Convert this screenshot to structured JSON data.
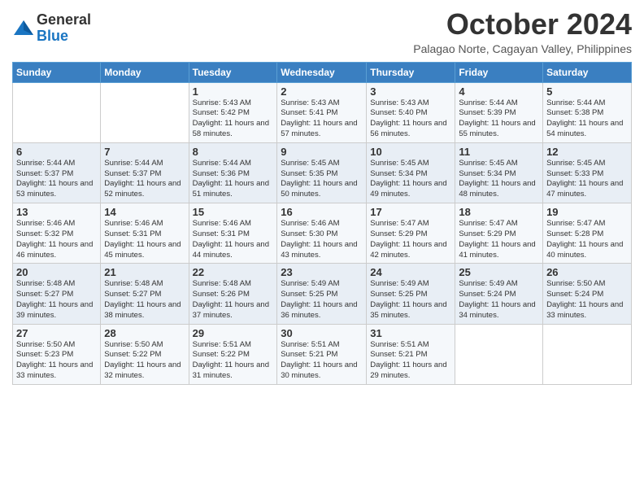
{
  "header": {
    "logo": {
      "general": "General",
      "blue": "Blue"
    },
    "title": "October 2024",
    "location": "Palagao Norte, Cagayan Valley, Philippines"
  },
  "weekdays": [
    "Sunday",
    "Monday",
    "Tuesday",
    "Wednesday",
    "Thursday",
    "Friday",
    "Saturday"
  ],
  "weeks": [
    [
      {
        "day": "",
        "detail": ""
      },
      {
        "day": "",
        "detail": ""
      },
      {
        "day": "1",
        "detail": "Sunrise: 5:43 AM\nSunset: 5:42 PM\nDaylight: 11 hours and 58 minutes."
      },
      {
        "day": "2",
        "detail": "Sunrise: 5:43 AM\nSunset: 5:41 PM\nDaylight: 11 hours and 57 minutes."
      },
      {
        "day": "3",
        "detail": "Sunrise: 5:43 AM\nSunset: 5:40 PM\nDaylight: 11 hours and 56 minutes."
      },
      {
        "day": "4",
        "detail": "Sunrise: 5:44 AM\nSunset: 5:39 PM\nDaylight: 11 hours and 55 minutes."
      },
      {
        "day": "5",
        "detail": "Sunrise: 5:44 AM\nSunset: 5:38 PM\nDaylight: 11 hours and 54 minutes."
      }
    ],
    [
      {
        "day": "6",
        "detail": "Sunrise: 5:44 AM\nSunset: 5:37 PM\nDaylight: 11 hours and 53 minutes."
      },
      {
        "day": "7",
        "detail": "Sunrise: 5:44 AM\nSunset: 5:37 PM\nDaylight: 11 hours and 52 minutes."
      },
      {
        "day": "8",
        "detail": "Sunrise: 5:44 AM\nSunset: 5:36 PM\nDaylight: 11 hours and 51 minutes."
      },
      {
        "day": "9",
        "detail": "Sunrise: 5:45 AM\nSunset: 5:35 PM\nDaylight: 11 hours and 50 minutes."
      },
      {
        "day": "10",
        "detail": "Sunrise: 5:45 AM\nSunset: 5:34 PM\nDaylight: 11 hours and 49 minutes."
      },
      {
        "day": "11",
        "detail": "Sunrise: 5:45 AM\nSunset: 5:34 PM\nDaylight: 11 hours and 48 minutes."
      },
      {
        "day": "12",
        "detail": "Sunrise: 5:45 AM\nSunset: 5:33 PM\nDaylight: 11 hours and 47 minutes."
      }
    ],
    [
      {
        "day": "13",
        "detail": "Sunrise: 5:46 AM\nSunset: 5:32 PM\nDaylight: 11 hours and 46 minutes."
      },
      {
        "day": "14",
        "detail": "Sunrise: 5:46 AM\nSunset: 5:31 PM\nDaylight: 11 hours and 45 minutes."
      },
      {
        "day": "15",
        "detail": "Sunrise: 5:46 AM\nSunset: 5:31 PM\nDaylight: 11 hours and 44 minutes."
      },
      {
        "day": "16",
        "detail": "Sunrise: 5:46 AM\nSunset: 5:30 PM\nDaylight: 11 hours and 43 minutes."
      },
      {
        "day": "17",
        "detail": "Sunrise: 5:47 AM\nSunset: 5:29 PM\nDaylight: 11 hours and 42 minutes."
      },
      {
        "day": "18",
        "detail": "Sunrise: 5:47 AM\nSunset: 5:29 PM\nDaylight: 11 hours and 41 minutes."
      },
      {
        "day": "19",
        "detail": "Sunrise: 5:47 AM\nSunset: 5:28 PM\nDaylight: 11 hours and 40 minutes."
      }
    ],
    [
      {
        "day": "20",
        "detail": "Sunrise: 5:48 AM\nSunset: 5:27 PM\nDaylight: 11 hours and 39 minutes."
      },
      {
        "day": "21",
        "detail": "Sunrise: 5:48 AM\nSunset: 5:27 PM\nDaylight: 11 hours and 38 minutes."
      },
      {
        "day": "22",
        "detail": "Sunrise: 5:48 AM\nSunset: 5:26 PM\nDaylight: 11 hours and 37 minutes."
      },
      {
        "day": "23",
        "detail": "Sunrise: 5:49 AM\nSunset: 5:25 PM\nDaylight: 11 hours and 36 minutes."
      },
      {
        "day": "24",
        "detail": "Sunrise: 5:49 AM\nSunset: 5:25 PM\nDaylight: 11 hours and 35 minutes."
      },
      {
        "day": "25",
        "detail": "Sunrise: 5:49 AM\nSunset: 5:24 PM\nDaylight: 11 hours and 34 minutes."
      },
      {
        "day": "26",
        "detail": "Sunrise: 5:50 AM\nSunset: 5:24 PM\nDaylight: 11 hours and 33 minutes."
      }
    ],
    [
      {
        "day": "27",
        "detail": "Sunrise: 5:50 AM\nSunset: 5:23 PM\nDaylight: 11 hours and 33 minutes."
      },
      {
        "day": "28",
        "detail": "Sunrise: 5:50 AM\nSunset: 5:22 PM\nDaylight: 11 hours and 32 minutes."
      },
      {
        "day": "29",
        "detail": "Sunrise: 5:51 AM\nSunset: 5:22 PM\nDaylight: 11 hours and 31 minutes."
      },
      {
        "day": "30",
        "detail": "Sunrise: 5:51 AM\nSunset: 5:21 PM\nDaylight: 11 hours and 30 minutes."
      },
      {
        "day": "31",
        "detail": "Sunrise: 5:51 AM\nSunset: 5:21 PM\nDaylight: 11 hours and 29 minutes."
      },
      {
        "day": "",
        "detail": ""
      },
      {
        "day": "",
        "detail": ""
      }
    ]
  ]
}
